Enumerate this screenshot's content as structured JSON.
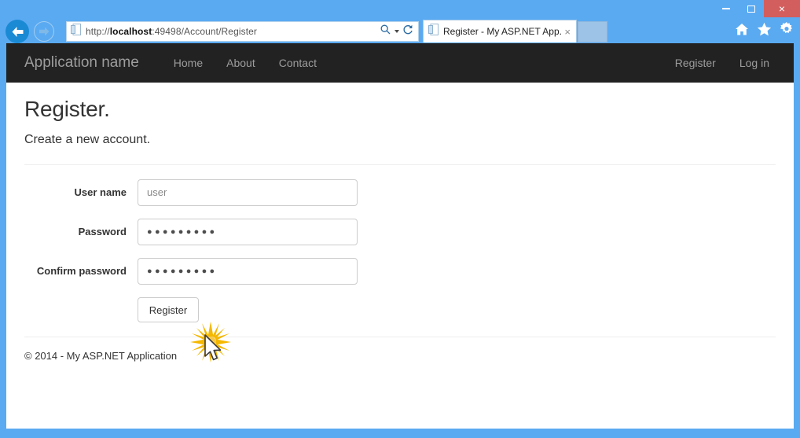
{
  "browser": {
    "url_prefix": "http://",
    "url_host": "localhost",
    "url_suffix": ":49498/Account/Register",
    "url_full": "http://localhost:49498/Account/Register",
    "tab_title": "Register - My ASP.NET App...",
    "tab_close_label": "×",
    "new_tab_label": "",
    "window_controls": {
      "minimize": "minimize",
      "maximize": "maximize",
      "close": "×"
    },
    "toolbar_icons": [
      "home-icon",
      "favorites-star-icon",
      "settings-gear-icon"
    ],
    "address_icons": [
      "page-document-icon",
      "search-magnifier-icon",
      "search-dropdown-caret-icon",
      "refresh-icon"
    ],
    "nav_icons": [
      "back-arrow-icon",
      "forward-arrow-icon"
    ],
    "chrome_accent_color": "#5aaaf2",
    "close_button_color": "#d35e5e"
  },
  "navbar": {
    "brand": "Application name",
    "links": [
      {
        "label": "Home"
      },
      {
        "label": "About"
      },
      {
        "label": "Contact"
      }
    ],
    "right_links": [
      {
        "label": "Register"
      },
      {
        "label": "Log in"
      }
    ],
    "background_color": "#222222",
    "link_color": "#9d9d9d"
  },
  "page": {
    "title": "Register.",
    "subtitle": "Create a new account.",
    "form": {
      "fields": [
        {
          "label": "User name",
          "value": "user",
          "type": "text",
          "is_placeholder": true
        },
        {
          "label": "Password",
          "value": "●●●●●●●●●",
          "type": "password",
          "dot_count": 9
        },
        {
          "label": "Confirm password",
          "value": "●●●●●●●●●",
          "type": "password",
          "dot_count": 9
        }
      ],
      "submit_label": "Register"
    },
    "footer": "© 2014 - My ASP.NET Application"
  },
  "overlay": {
    "click_effect_color": "#f5b800",
    "cursor": "arrow-pointer"
  }
}
